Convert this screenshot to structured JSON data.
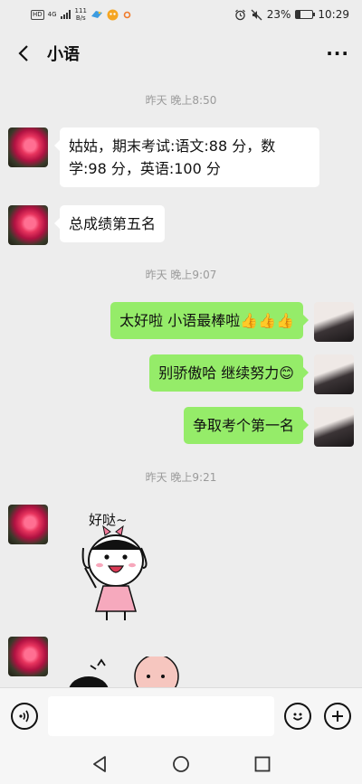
{
  "status_bar": {
    "network_badge": "HD",
    "network_gen": "4G",
    "speed_value": "111",
    "speed_unit": "B/s",
    "battery": "23%",
    "battery_level": 0.23,
    "time": "10:29"
  },
  "header": {
    "title": "小语",
    "more_label": "···"
  },
  "messages": [
    {
      "type": "time",
      "text": "昨天 晚上8:50"
    },
    {
      "type": "text",
      "from": "contact",
      "text": "姑姑，期末考试:语文:88 分，数学:98 分，英语:100 分"
    },
    {
      "type": "text",
      "from": "contact",
      "text": "总成绩第五名"
    },
    {
      "type": "time",
      "text": "昨天 晚上9:07"
    },
    {
      "type": "text",
      "from": "me",
      "text": "太好啦 小语最棒啦👍👍👍"
    },
    {
      "type": "text",
      "from": "me",
      "text": "别骄傲哈  继续努力😊"
    },
    {
      "type": "text",
      "from": "me",
      "text": "争取考个第一名"
    },
    {
      "type": "time",
      "text": "昨天 晚上9:21"
    },
    {
      "type": "sticker",
      "from": "contact",
      "caption": "好哒~"
    },
    {
      "type": "sticker",
      "from": "contact",
      "caption": ""
    }
  ],
  "input": {
    "value": "",
    "placeholder": ""
  },
  "icons": {
    "back": "chevron-left-icon",
    "more": "more-horizontal-icon",
    "voice": "voice-icon",
    "emoji": "emoji-icon",
    "plus": "plus-icon",
    "nav_back": "nav-back-icon",
    "nav_home": "nav-home-icon",
    "nav_recent": "nav-recent-icon"
  },
  "colors": {
    "outgoing_bubble": "#95ec69",
    "incoming_bubble": "#ffffff",
    "chat_background": "#ededed"
  }
}
